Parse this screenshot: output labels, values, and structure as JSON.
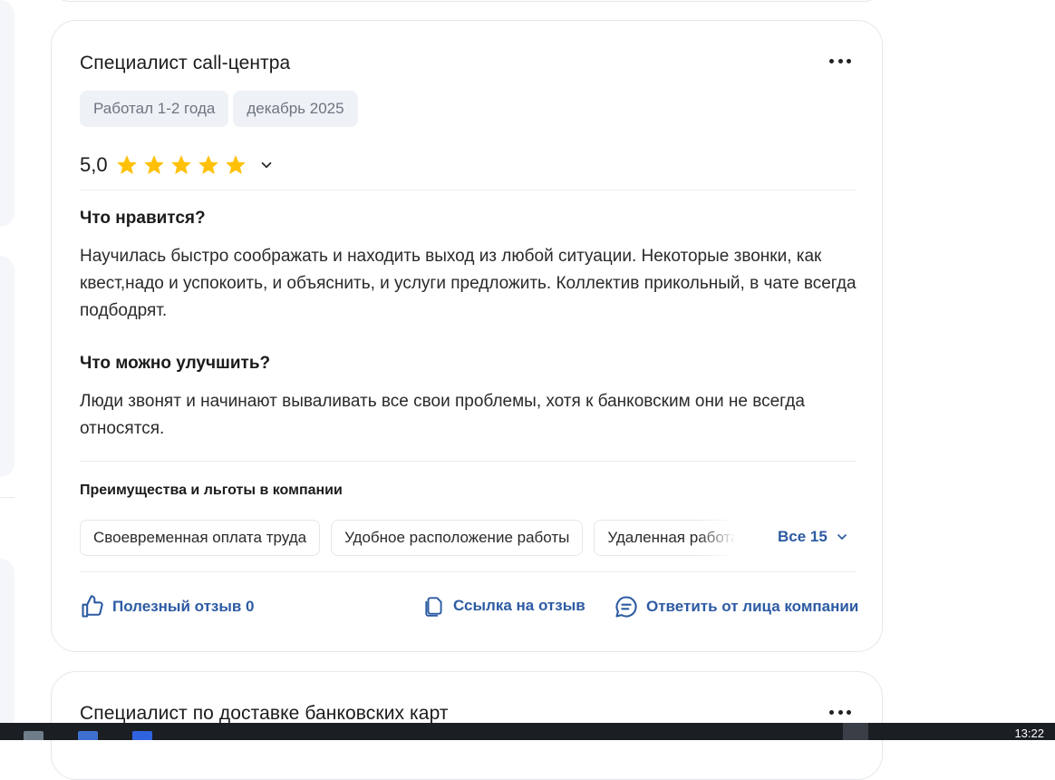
{
  "review": {
    "title": "Специалист call-центра",
    "tags": [
      "Работал 1-2 года",
      "декабрь 2025"
    ],
    "rating": "5,0",
    "stars_filled": 5,
    "stars_total": 5,
    "star_color": "#ffc107",
    "likes_heading": "Что нравится?",
    "likes_text": "Научилась быстро соображать и находить выход из любой ситуации. Некоторые звонки, как квест,надо и успокоить, и объяснить, и услуги предложить. Коллектив прикольный, в чате всегда подбодрят.",
    "improve_heading": "Что можно улучшить?",
    "improve_text": "Люди звонят и начинают вываливать все свои проблемы, хотя к банковским они не всегда относятся.",
    "benefits_heading": "Преимущества и льготы в компании",
    "benefits": [
      "Своевременная оплата труда",
      "Удобное расположение работы",
      "Удаленная работа"
    ],
    "benefits_all": "Все 15",
    "actions": {
      "useful": "Полезный отзыв 0",
      "link": "Ссылка на отзыв",
      "reply": "Ответить от лица компании"
    },
    "accent_color": "#2d5ba3"
  },
  "next_review": {
    "title": "Специалист по доставке банковских карт"
  },
  "taskbar": {
    "clock": "13:22"
  }
}
